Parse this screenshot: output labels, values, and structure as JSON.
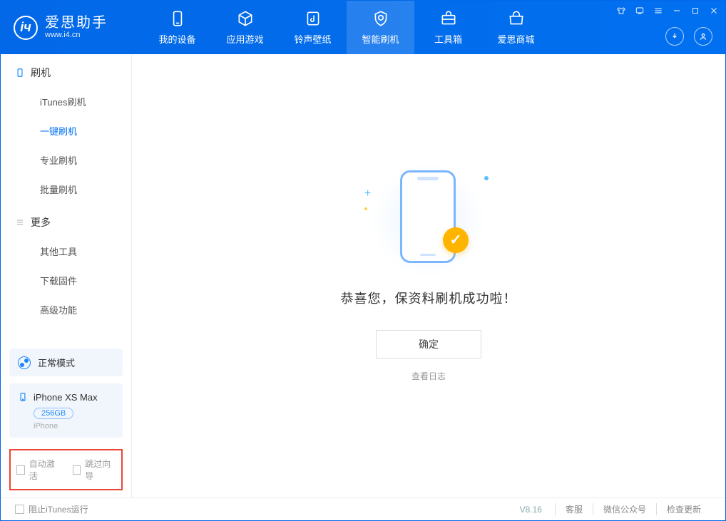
{
  "brand": {
    "name": "爱思助手",
    "url": "www.i4.cn"
  },
  "topTabs": [
    {
      "label": "我的设备",
      "icon": "phone-icon"
    },
    {
      "label": "应用游戏",
      "icon": "cube-icon"
    },
    {
      "label": "铃声壁纸",
      "icon": "music-icon"
    },
    {
      "label": "智能刷机",
      "icon": "shield-icon",
      "active": true
    },
    {
      "label": "工具箱",
      "icon": "toolbox-icon"
    },
    {
      "label": "爱思商城",
      "icon": "shop-icon"
    }
  ],
  "sidebar": {
    "section1": {
      "title": "刷机"
    },
    "items1": [
      {
        "label": "iTunes刷机"
      },
      {
        "label": "一键刷机",
        "active": true
      },
      {
        "label": "专业刷机"
      },
      {
        "label": "批量刷机"
      }
    ],
    "section2": {
      "title": "更多"
    },
    "items2": [
      {
        "label": "其他工具"
      },
      {
        "label": "下载固件"
      },
      {
        "label": "高级功能"
      }
    ]
  },
  "modeCard": {
    "label": "正常模式"
  },
  "deviceCard": {
    "name": "iPhone XS Max",
    "storage": "256GB",
    "type": "iPhone"
  },
  "bottomOptions": {
    "opt1": "自动激活",
    "opt2": "跳过向导"
  },
  "main": {
    "successMessage": "恭喜您，保资料刷机成功啦！",
    "confirmLabel": "确定",
    "logLink": "查看日志"
  },
  "statusbar": {
    "blockItunes": "阻止iTunes运行",
    "version": "V8.16",
    "links": [
      "客服",
      "微信公众号",
      "检查更新"
    ]
  }
}
